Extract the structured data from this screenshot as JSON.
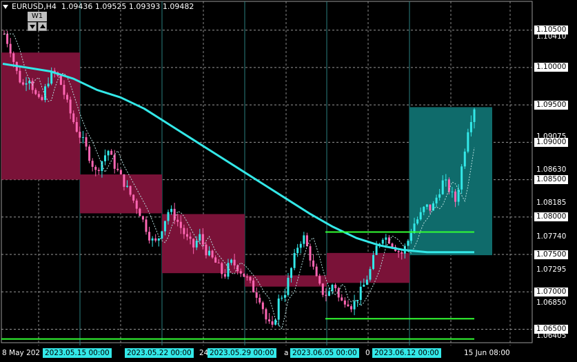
{
  "header": {
    "symbol": "EURUSD,H4",
    "ohlc": "1.09436 1.09525 1.09393 1.09482"
  },
  "period_widget": {
    "label": "W1"
  },
  "price_axis": {
    "highlighted": [
      "1.10500",
      "1.10000",
      "1.09500",
      "1.09000",
      "1.08500",
      "1.08000",
      "1.07500",
      "1.07000",
      "1.06500"
    ],
    "plain": [
      "1.10410",
      "1.09075",
      "1.08630",
      "1.08185",
      "1.07740",
      "1.07295",
      "1.06850",
      "1.06405"
    ]
  },
  "time_axis": {
    "plain": [
      {
        "text": "8 May 202",
        "x": 3
      },
      {
        "text": "24",
        "x": 289
      },
      {
        "text": "a",
        "x": 412
      },
      {
        "text": "0",
        "x": 530
      },
      {
        "text": "15 Jun 08:00",
        "x": 673
      }
    ],
    "highlighted": [
      {
        "text": "2023.05.15 00:00",
        "x": 62
      },
      {
        "text": "2023.05.22 00:00",
        "x": 181
      },
      {
        "text": "2023.05.29 00:00",
        "x": 301
      },
      {
        "text": "2023.06.05 00:00",
        "x": 421
      },
      {
        "text": "2023.06.12 00:00",
        "x": 540
      }
    ]
  },
  "colors": {
    "background": "#000000",
    "bull_candle": "#33e8e8",
    "bear_candle": "#ff66b3",
    "weekly_bear_box": "#7a1238",
    "weekly_bull_box": "#0f6b6b",
    "moving_average": "#33e8e8",
    "horizontal_levels": "#33ff33"
  },
  "chart_data": {
    "type": "candlestick",
    "symbol": "EURUSD",
    "timeframe": "H4",
    "y_range": [
      1.0632,
      1.107
    ],
    "horizontal_levels": [
      1.078,
      1.0664,
      1.0637
    ],
    "weekly_boxes": [
      {
        "start": "2023.05.08",
        "open": 1.102,
        "close": 1.085,
        "direction": "bear"
      },
      {
        "start": "2023.05.15",
        "open": 1.0857,
        "close": 1.0805,
        "direction": "bear"
      },
      {
        "start": "2023.05.22",
        "open": 1.0804,
        "close": 1.0725,
        "direction": "bear"
      },
      {
        "start": "2023.05.29",
        "open": 1.0722,
        "close": 1.0707,
        "direction": "bear"
      },
      {
        "start": "2023.06.05",
        "open": 1.0752,
        "close": 1.0712,
        "direction": "bear"
      },
      {
        "start": "2023.06.12",
        "open": 1.0749,
        "close": 1.0947,
        "direction": "bull"
      }
    ],
    "close_path": [
      1.1045,
      1.1025,
      1.0995,
      1.0975,
      1.099,
      1.0965,
      1.095,
      1.098,
      1.0995,
      1.0985,
      1.096,
      1.0935,
      1.0915,
      1.09,
      1.088,
      1.086,
      1.0875,
      1.089,
      1.087,
      1.0855,
      1.084,
      1.0825,
      1.081,
      1.079,
      1.077,
      1.0765,
      1.079,
      1.081,
      1.08,
      1.0785,
      1.077,
      1.076,
      1.0775,
      1.0755,
      1.0745,
      1.0735,
      1.072,
      1.074,
      1.0735,
      1.0725,
      1.0715,
      1.07,
      1.069,
      1.066,
      1.065,
      1.069,
      1.07,
      1.073,
      1.076,
      1.0775,
      1.075,
      1.072,
      1.07,
      1.0695,
      1.0715,
      1.0685,
      1.069,
      1.068,
      1.0695,
      1.071,
      1.073,
      1.076,
      1.0775,
      1.077,
      1.076,
      1.075,
      1.0765,
      1.079,
      1.08,
      1.0815,
      1.081,
      1.083,
      1.085,
      1.0835,
      1.082,
      1.087,
      1.092,
      1.0947
    ],
    "moving_average_path": [
      1.1005,
      1.1,
      1.0995,
      1.0985,
      1.097,
      1.096,
      1.0945,
      1.0925,
      1.0905,
      1.0885,
      1.0865,
      1.0845,
      1.0825,
      1.0805,
      1.0787,
      1.0772,
      1.0762,
      1.0756,
      1.0753,
      1.0753,
      1.0753
    ]
  }
}
